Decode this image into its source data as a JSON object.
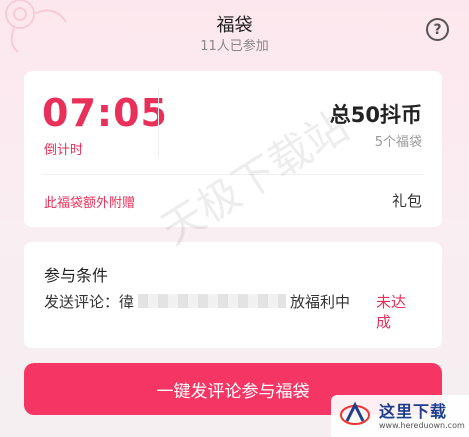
{
  "header": {
    "title": "福袋",
    "participants": "11人已参加",
    "help_icon": "help-circle-icon"
  },
  "prize_card": {
    "countdown": "07:05",
    "countdown_label": "倒计时",
    "total": "总50抖币",
    "count": "5个福袋",
    "extra_label": "此福袋额外附赠",
    "extra_value": "礼包"
  },
  "condition_card": {
    "title": "参与条件",
    "text_start": "发送评论：徫",
    "text_end": "放福利中",
    "status": "未达成"
  },
  "cta": {
    "label": "一键发评论参与福袋"
  },
  "watermark": "天极下载站",
  "corner_logo": {
    "brand": "这里下载",
    "url": "www.hereduown.com"
  },
  "colors": {
    "accent": "#e8305a",
    "button": "#f53563",
    "background": "#fde7ee"
  }
}
